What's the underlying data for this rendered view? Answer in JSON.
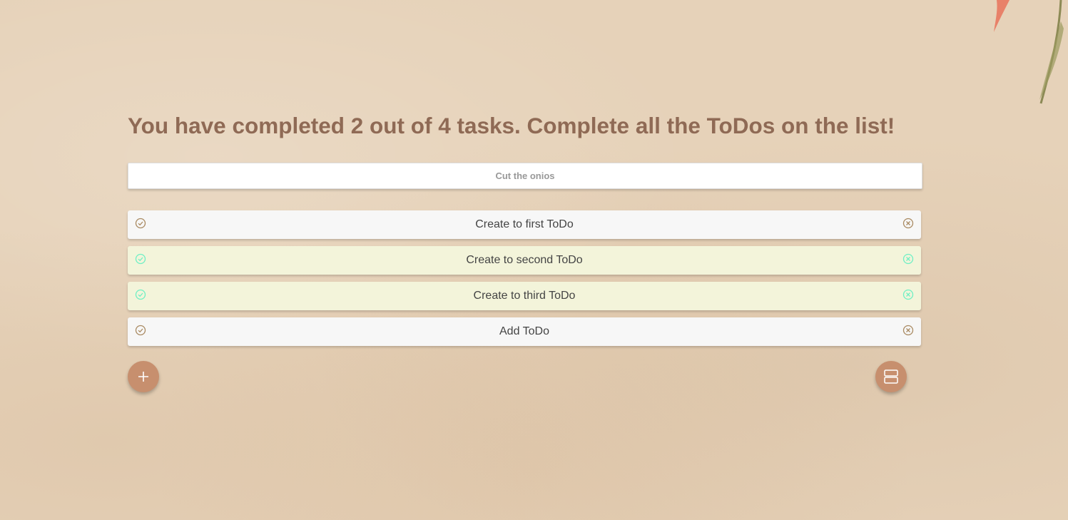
{
  "header": {
    "headline": "You have completed 2 out of 4 tasks. Complete all the ToDos on the list!"
  },
  "new_todo": {
    "placeholder": "Cut the onios"
  },
  "todos": [
    {
      "label": "Create to first ToDo",
      "done": false
    },
    {
      "label": "Create to second ToDo",
      "done": true
    },
    {
      "label": "Create to third ToDo",
      "done": true
    },
    {
      "label": "Add ToDo",
      "done": false
    }
  ],
  "icons": {
    "check": "check-circle-icon",
    "remove": "close-circle-icon",
    "add": "plus-icon",
    "layout": "layout-rows-icon",
    "decor": "leaf-decoration"
  },
  "colors": {
    "background": "#e6d2b9",
    "headline": "#8f6a55",
    "accent": "#c78f6e",
    "done_row": "#f3f4da",
    "pending_row": "#f7f7f7",
    "done_icon": "#6ff0c4",
    "pending_icon": "#a98a62"
  }
}
